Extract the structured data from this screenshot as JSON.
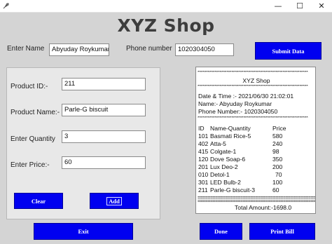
{
  "window": {
    "minimize_glyph": "—",
    "maximize_glyph": "☐",
    "close_glyph": "✕"
  },
  "header": {
    "title": "XYZ Shop",
    "name_label": "Enter Name",
    "name_value": "Abyuday Roykumar",
    "phone_label": "Phone number",
    "phone_value": "1020304050",
    "submit_label": "Submit Data"
  },
  "product_form": {
    "id_label": "Product ID:-",
    "id_value": "211",
    "name_label": "Product Name:-",
    "name_value": "Parle-G biscuit",
    "qty_label": "Enter Quantity",
    "qty_value": "3",
    "price_label": "Enter Price:-",
    "price_value": "60",
    "clear_label": "Clear",
    "add_label": "Add"
  },
  "bill": {
    "stars": "*****************************************************************",
    "shop_name": "XYZ Shop",
    "datetime": "Date & Time :- 2021/06/30 21:02:01",
    "customer_name": "Name:- Abyuday Roykumar",
    "phone_number": "Phone Number:- 1020304050",
    "col_id": "ID",
    "col_name_qty": "Name-Quantity",
    "col_price": "Price",
    "items": [
      {
        "id": "101",
        "name_qty": "Basmati Rice-5",
        "price": "580"
      },
      {
        "id": "402",
        "name_qty": "Atta-5",
        "price": "240"
      },
      {
        "id": "415",
        "name_qty": "Colgate-1",
        "price": "98"
      },
      {
        "id": "120",
        "name_qty": "Dove Soap-6",
        "price": "350"
      },
      {
        "id": "201",
        "name_qty": "Lux Deo-2",
        "price": "200"
      },
      {
        "id": "010",
        "name_qty": "Detol-1",
        "price": "70"
      },
      {
        "id": "301",
        "name_qty": "LED Bulb-2",
        "price": "100"
      },
      {
        "id": "211",
        "name_qty": "Parle-G biscuit-3",
        "price": "60"
      }
    ],
    "equals": "=================================================================",
    "total": "Total Amount:-1698.0"
  },
  "footer": {
    "exit_label": "Exit",
    "done_label": "Done",
    "print_label": "Print Bill"
  },
  "colors": {
    "button_blue": "#0000f0",
    "window_bg": "#d4d4d4",
    "panel_bg": "#e8e8e8"
  }
}
